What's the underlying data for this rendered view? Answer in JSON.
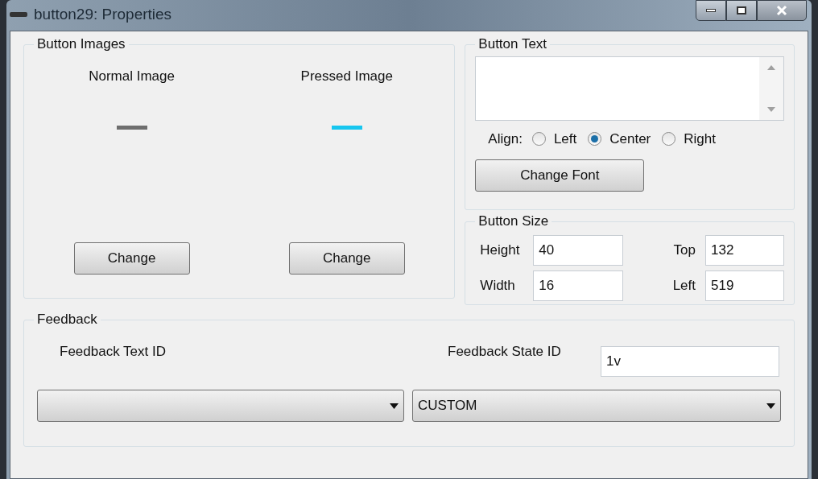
{
  "window": {
    "title": "button29: Properties"
  },
  "button_images": {
    "title": "Button Images",
    "images": [
      {
        "label": "Normal Image",
        "kind": "normal",
        "button": "Change"
      },
      {
        "label": "Pressed Image",
        "kind": "pressed",
        "button": "Change"
      }
    ]
  },
  "button_text": {
    "title": "Button Text",
    "align_label": "Align:",
    "align_options": [
      {
        "label": "Left",
        "selected": false
      },
      {
        "label": "Center",
        "selected": true
      },
      {
        "label": "Right",
        "selected": false
      }
    ],
    "font_button": "Change Font"
  },
  "button_size": {
    "title": "Button Size",
    "fields": [
      {
        "label": "Height",
        "value": "40"
      },
      {
        "label": "Top",
        "value": "132"
      },
      {
        "label": "Width",
        "value": "16"
      },
      {
        "label": "Left",
        "value": "519"
      }
    ]
  },
  "feedback": {
    "title": "Feedback",
    "text_id_label": "Feedback Text ID",
    "state_id_label": "Feedback State ID",
    "state_id_value": "1v",
    "state_dropdown": "CUSTOM"
  }
}
